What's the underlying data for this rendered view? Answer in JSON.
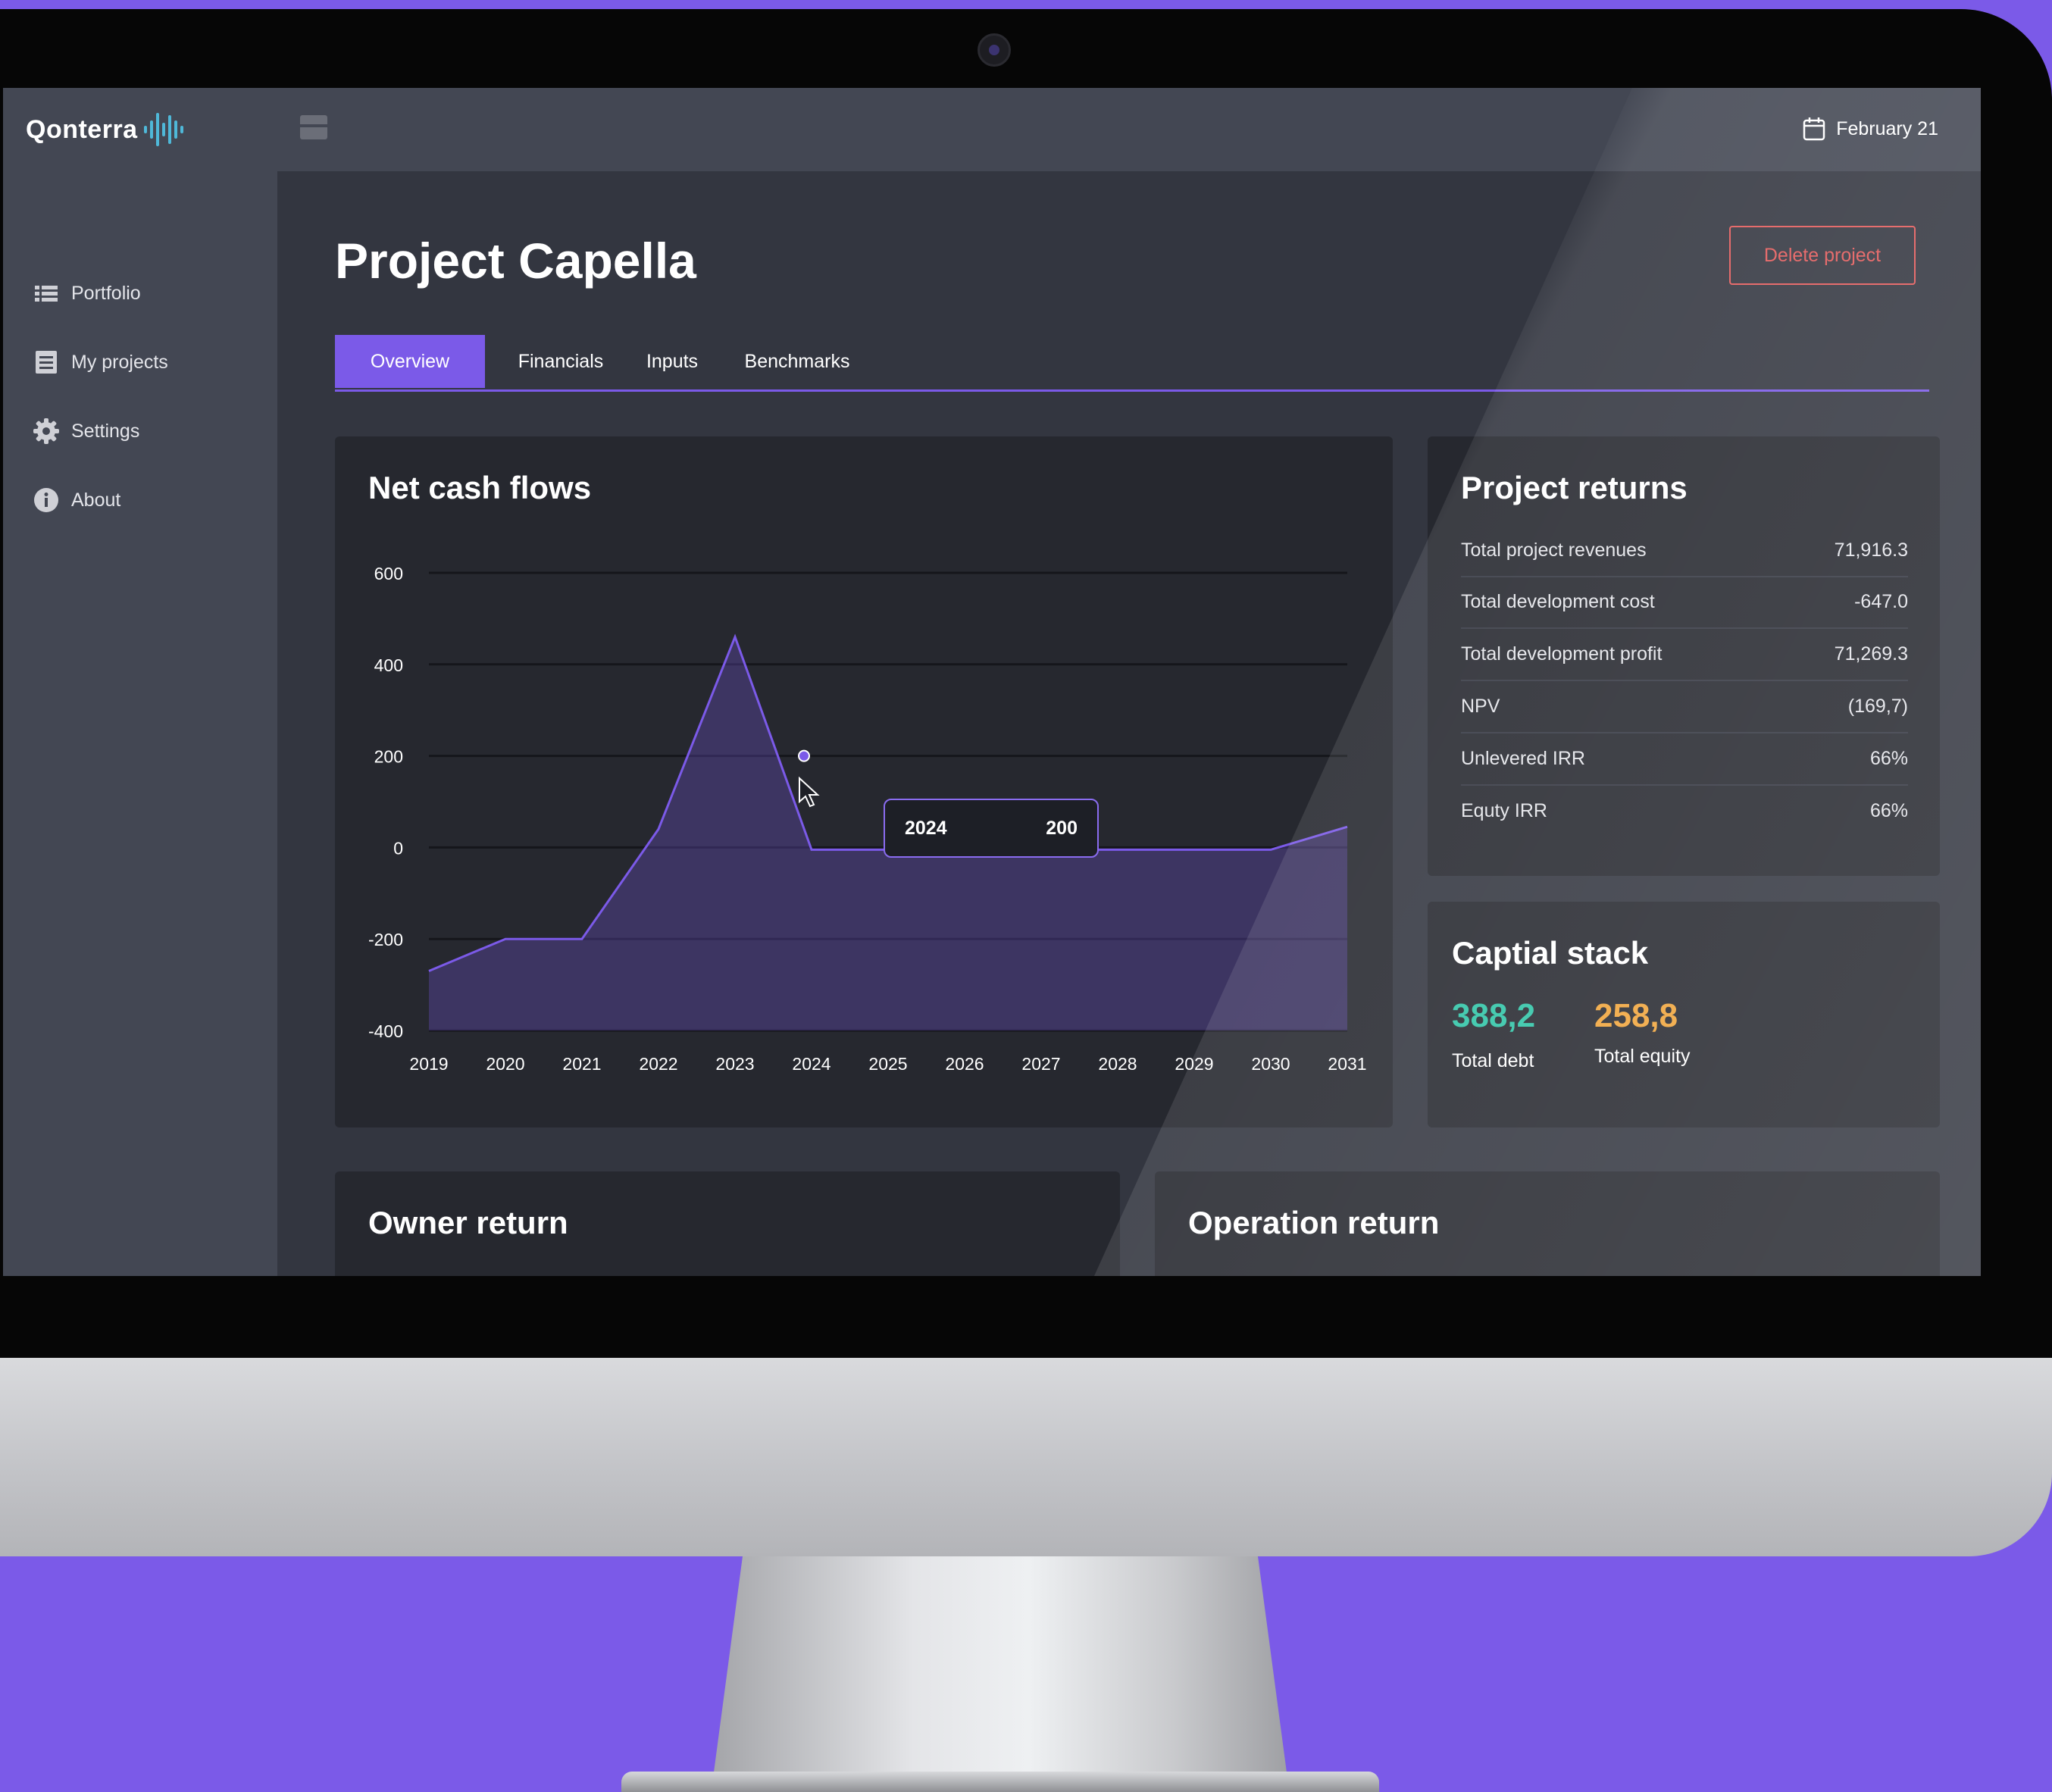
{
  "app": {
    "logo_text": "Qonterra",
    "date": "February 21"
  },
  "sidebar": {
    "items": [
      {
        "label": "Portfolio",
        "icon": "list-icon"
      },
      {
        "label": "My projects",
        "icon": "document-icon"
      },
      {
        "label": "Settings",
        "icon": "gear-icon"
      },
      {
        "label": "About",
        "icon": "info-icon"
      }
    ]
  },
  "page": {
    "title": "Project Capella",
    "delete_label": "Delete project"
  },
  "tabs": [
    {
      "label": "Overview",
      "active": true
    },
    {
      "label": "Financials",
      "active": false
    },
    {
      "label": "Inputs",
      "active": false
    },
    {
      "label": "Benchmarks",
      "active": false
    }
  ],
  "net_cash_flows": {
    "title": "Net cash flows",
    "tooltip": {
      "year": "2024",
      "value": "200"
    }
  },
  "chart_data": {
    "type": "area",
    "title": "Net cash flows",
    "x": [
      "2019",
      "2020",
      "2021",
      "2022",
      "2023",
      "2024",
      "2025",
      "2026",
      "2027",
      "2028",
      "2029",
      "2030",
      "2031"
    ],
    "series": [
      {
        "values": [
          -270,
          -200,
          -200,
          40,
          460,
          -5,
          -5,
          -5,
          -5,
          -5,
          -5,
          -5,
          45
        ]
      }
    ],
    "y_ticks": [
      600,
      400,
      200,
      0,
      -200,
      -400
    ],
    "ylim": [
      -400,
      600
    ],
    "grid": true,
    "highlighted_point": {
      "x": "2024",
      "y": 200
    },
    "color": "#7b5ae8"
  },
  "project_returns": {
    "title": "Project returns",
    "rows": [
      {
        "label": "Total project revenues",
        "value": "71,916.3"
      },
      {
        "label": "Total development cost",
        "value": "-647.0"
      },
      {
        "label": "Total development profit",
        "value": "71,269.3"
      },
      {
        "label": "NPV",
        "value": "(169,7)"
      },
      {
        "label": "Unlevered IRR",
        "value": "66%"
      },
      {
        "label": "Equty IRR",
        "value": "66%"
      }
    ]
  },
  "capital_stack": {
    "title": "Captial stack",
    "debt": {
      "value": "388,2",
      "label": "Total debt",
      "color": "#2ec4a6"
    },
    "equity": {
      "value": "258,8",
      "label": "Total equity",
      "color": "#f0a43a"
    }
  },
  "owner_return": {
    "title": "Owner return"
  },
  "operation_return": {
    "title": "Operation return"
  },
  "colors": {
    "accent": "#7b5ae8",
    "danger": "#e35a5a",
    "background": "#333640",
    "card": "#26282f"
  }
}
